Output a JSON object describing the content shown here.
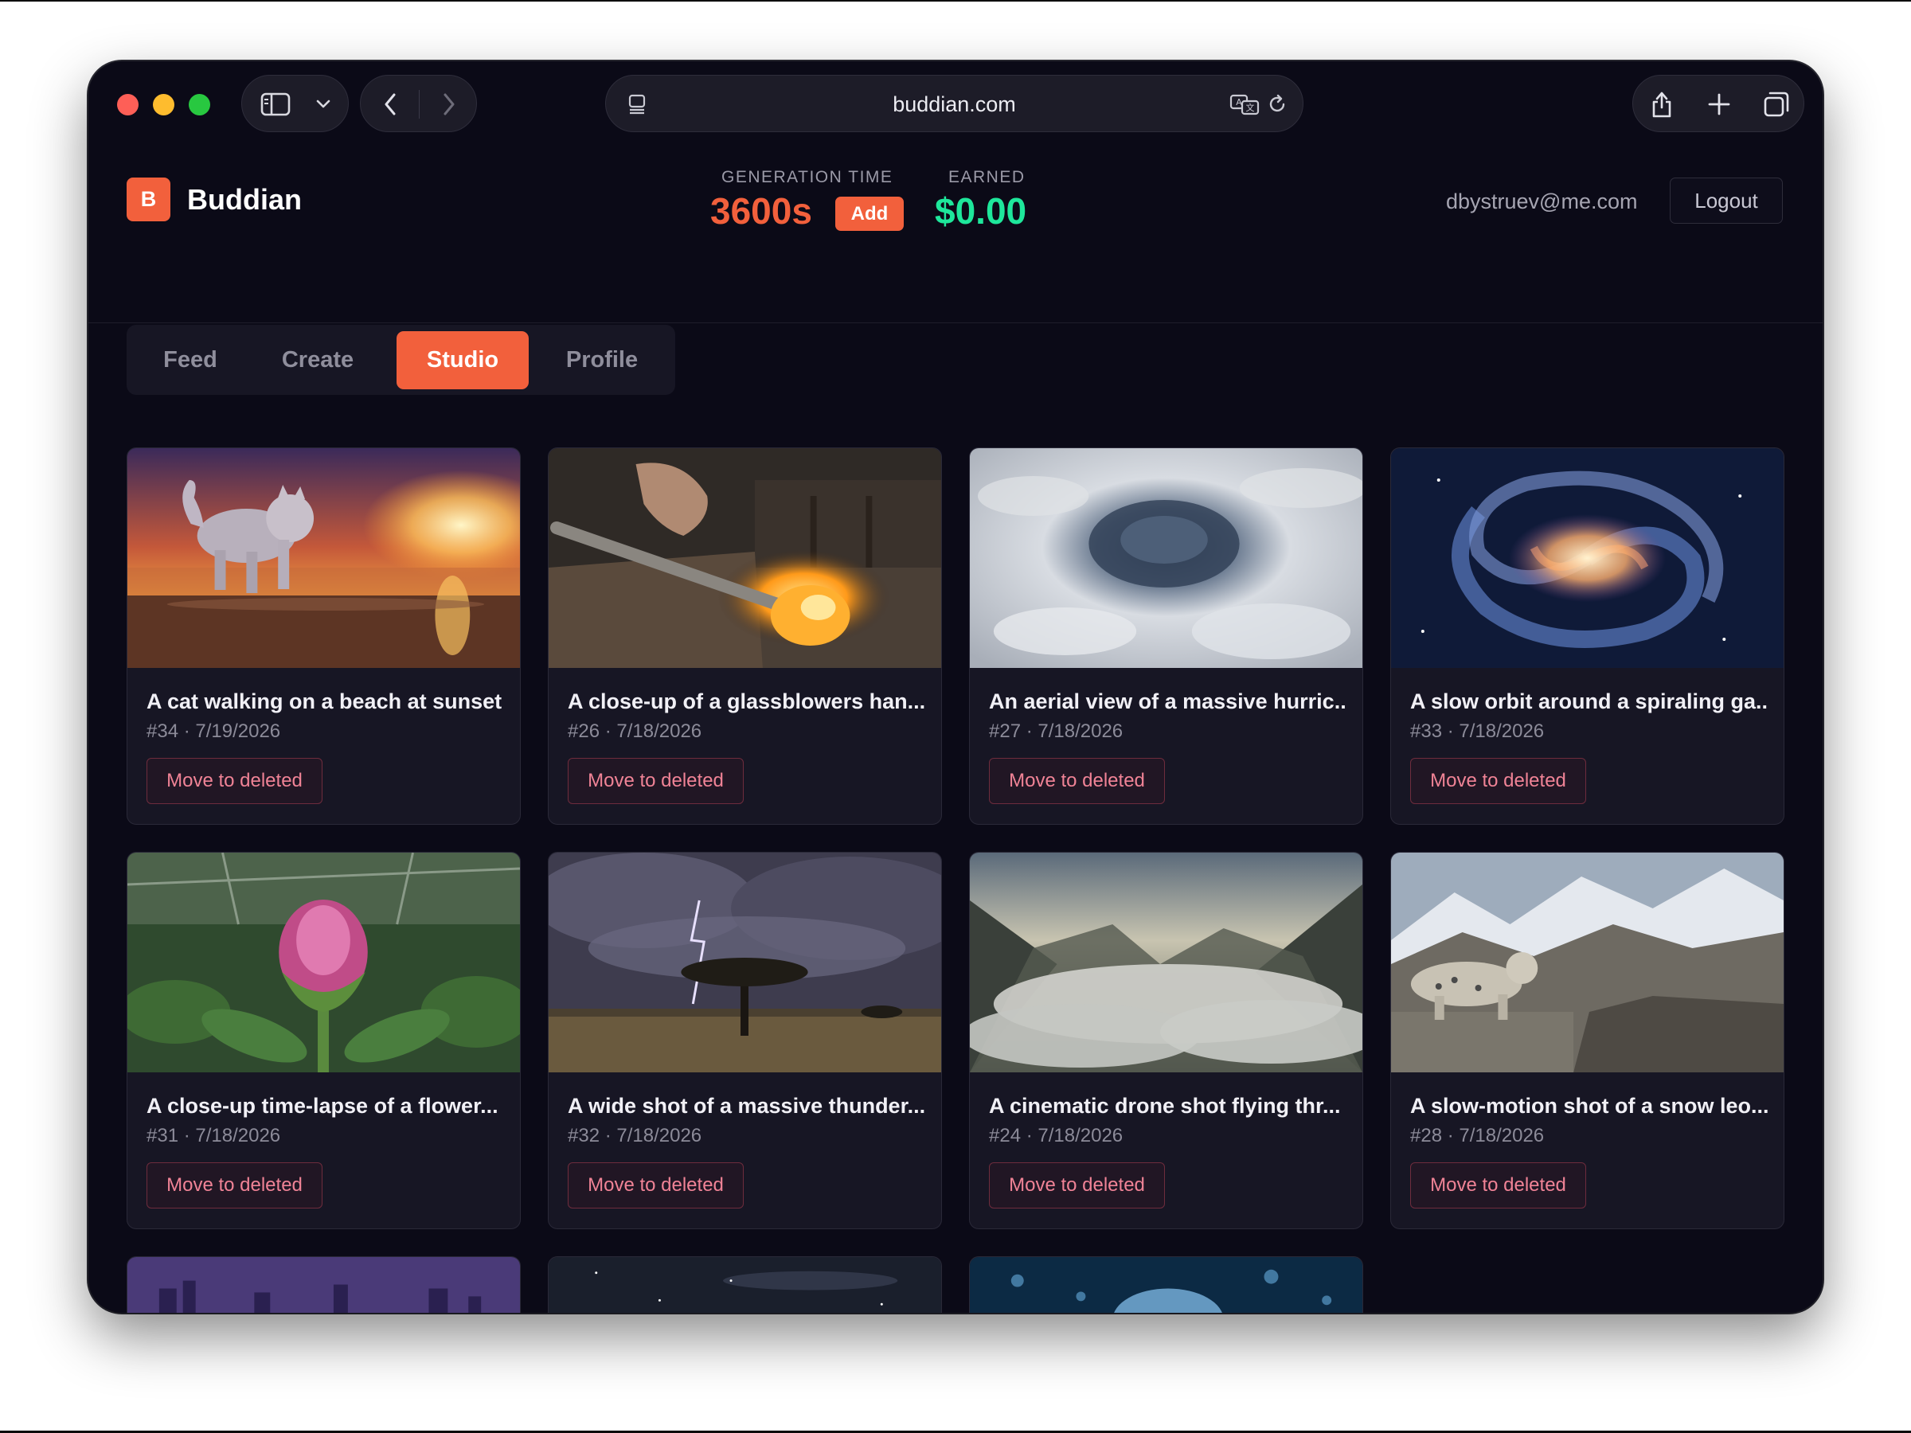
{
  "browser": {
    "url": "buddian.com"
  },
  "app": {
    "logo_letter": "B",
    "brand": "Buddian",
    "generation_time": {
      "label": "GENERATION TIME",
      "value": "3600s",
      "add_label": "Add"
    },
    "earned": {
      "label": "EARNED",
      "value": "$0.00"
    },
    "user_email": "dbystruev@me.com",
    "logout_label": "Logout",
    "accent_color": "#f2603c",
    "earned_color": "#1ee79b"
  },
  "tabs": [
    {
      "label": "Feed",
      "active": false
    },
    {
      "label": "Create",
      "active": false
    },
    {
      "label": "Studio",
      "active": true
    },
    {
      "label": "Profile",
      "active": false
    }
  ],
  "cards": [
    {
      "title": "A cat walking on a beach at sunset",
      "meta": "#34 · 7/19/2026",
      "action": "Move to deleted",
      "thumb": "sunset-beach-cat"
    },
    {
      "title": "A close-up of a glassblowers han...",
      "meta": "#26 · 7/18/2026",
      "action": "Move to deleted",
      "thumb": "glassblowing"
    },
    {
      "title": "An aerial view of a massive hurric...",
      "meta": "#27 · 7/18/2026",
      "action": "Move to deleted",
      "thumb": "hurricane-eye"
    },
    {
      "title": "A slow orbit around a spiraling ga...",
      "meta": "#33 · 7/18/2026",
      "action": "Move to deleted",
      "thumb": "spiral-galaxy"
    },
    {
      "title": "A close-up time-lapse of a flower...",
      "meta": "#31 · 7/18/2026",
      "action": "Move to deleted",
      "thumb": "peony-bud"
    },
    {
      "title": "A wide shot of a massive thunder...",
      "meta": "#32 · 7/18/2026",
      "action": "Move to deleted",
      "thumb": "savanna-storm"
    },
    {
      "title": "A cinematic drone shot flying thr...",
      "meta": "#24 · 7/18/2026",
      "action": "Move to deleted",
      "thumb": "misty-valley"
    },
    {
      "title": "A slow-motion shot of a snow leo...",
      "meta": "#28 · 7/18/2026",
      "action": "Move to deleted",
      "thumb": "snow-leopard"
    }
  ],
  "partial_cards": [
    {
      "thumb": "night-city"
    },
    {
      "thumb": "milky-way"
    },
    {
      "thumb": "jellyfish"
    }
  ]
}
